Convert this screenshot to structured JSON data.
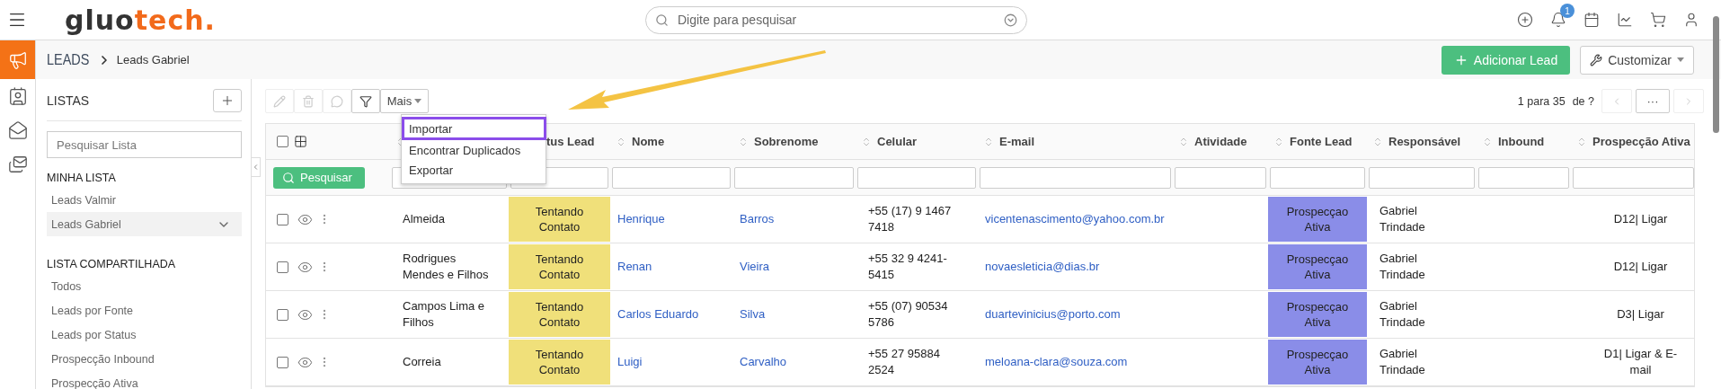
{
  "logo": [
    "gluo",
    "tech."
  ],
  "search": {
    "placeholder": "Digite para pesquisar"
  },
  "notifications": {
    "badge": "1"
  },
  "rail": [
    {
      "selected": true
    },
    {
      "selected": false
    },
    {
      "selected": false
    },
    {
      "selected": false
    }
  ],
  "breadcrumb": {
    "section": "LEADS",
    "current": "Leads Gabriel"
  },
  "actions": {
    "add": "Adicionar Lead",
    "customize": "Customizar"
  },
  "lists": {
    "title": "LISTAS",
    "search_placeholder": "Pesquisar Lista",
    "groups": [
      {
        "title": "MINHA LISTA",
        "items": [
          {
            "label": "Leads Valmir",
            "selected": false
          },
          {
            "label": "Leads Gabriel",
            "selected": true
          }
        ]
      },
      {
        "title": "LISTA COMPARTILHADA",
        "items": [
          {
            "label": "Todos",
            "selected": false
          },
          {
            "label": "Leads por Fonte",
            "selected": false
          },
          {
            "label": "Leads por Status",
            "selected": false
          },
          {
            "label": "Prospecção Inbound",
            "selected": false
          },
          {
            "label": "Prospecção Ativa",
            "selected": false
          }
        ]
      }
    ]
  },
  "toolbar": {
    "more": "Mais",
    "pagination": "1 para 35",
    "of": "de ?",
    "ellipsis": "···"
  },
  "menu": [
    {
      "label": "Importar",
      "selected": true
    },
    {
      "label": "Encontrar Duplicados",
      "selected": false
    },
    {
      "label": "Exportar",
      "selected": false
    }
  ],
  "search_button": "Pesquisar",
  "columns": [
    {
      "kind": "text"
    },
    {
      "kind": "status",
      "label": "tus Lead"
    },
    {
      "kind": "link",
      "label": "Nome"
    },
    {
      "kind": "link",
      "label": "Sobrenome"
    },
    {
      "kind": "text",
      "label": "Celular"
    },
    {
      "kind": "link",
      "label": "E-mail"
    },
    {
      "kind": "text",
      "label": "Atividade"
    },
    {
      "kind": "source",
      "label": "Fonte Lead"
    },
    {
      "kind": "text",
      "label": "Responsável"
    },
    {
      "kind": "text",
      "label": "Inbound"
    },
    {
      "kind": "end",
      "label": "Prospecção Ativa"
    }
  ],
  "all_checked": false,
  "rows": [
    {
      "checked": false,
      "cells": [
        "Almeida",
        "Tentando Contato",
        "Henrique",
        "Barros",
        "+55 (17) 9 1467 7418",
        "vicentenascimento@yahoo.com.br",
        null,
        "Prospecçao Ativa",
        "Gabriel Trindade",
        null,
        "D12| Ligar"
      ]
    },
    {
      "checked": false,
      "cells": [
        "Rodrigues Mendes e Filhos",
        "Tentando Contato",
        "Renan",
        "Vieira",
        "+55 32 9 4241-5415",
        "novaesleticia@dias.br",
        null,
        "Prospecçao Ativa",
        "Gabriel Trindade",
        null,
        "D12| Ligar"
      ]
    },
    {
      "checked": false,
      "cells": [
        "Campos Lima e Filhos",
        "Tentando Contato",
        "Carlos Eduardo",
        "Silva",
        "+55 (07) 90534 5786",
        "duartevinicius@porto.com",
        null,
        "Prospecçao Ativa",
        "Gabriel Trindade",
        null,
        "D3| Ligar"
      ]
    },
    {
      "checked": false,
      "cells": [
        "Correia",
        "Tentando Contato",
        "Luigi",
        "Carvalho",
        "+55 27 95884 2524",
        "meloana-clara@souza.com",
        null,
        "Prospecçao Ativa",
        "Gabriel Trindade",
        null,
        "D1| Ligar & E-mail"
      ]
    }
  ]
}
